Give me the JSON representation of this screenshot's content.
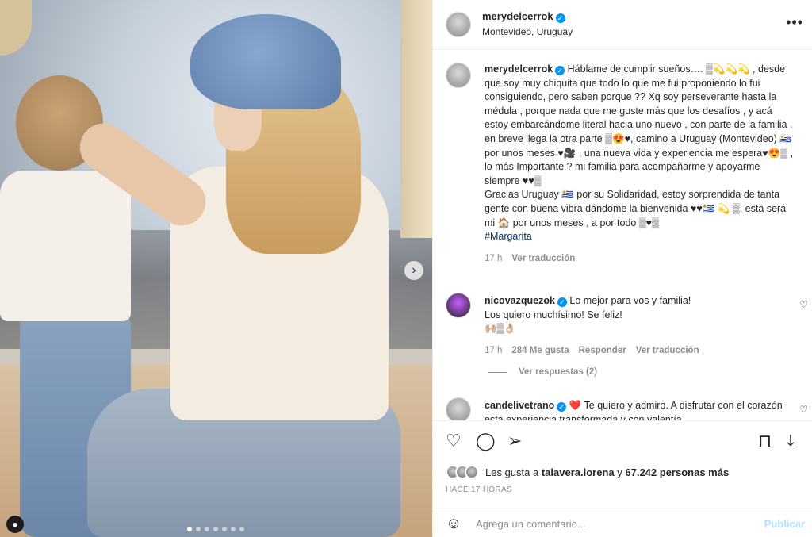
{
  "post": {
    "username": "merydelcerrok",
    "location": "Montevideo, Uruguay",
    "more_icon": "more-horizontal-icon",
    "carousel": {
      "slide_count": 7,
      "active_index": 0
    }
  },
  "caption": {
    "username": "merydelcerrok",
    "text": "Háblame de cumplir sueños…. ▒💫💫💫 , desde que soy muy chiquita que todo lo que me fui proponiendo lo fui consiguiendo, pero saben porque ?? Xq soy perseverante hasta la médula , porque nada que me guste más que los desafíos , y acá estoy embarcándome literal hacia uno nuevo , con parte de la familia , en breve llega la otra parte ▒😍♥, camino a Uruguay (Montevideo) 🇺🇾 por unos meses ♥🎥 , una nueva vida y experiencia me espera♥😍▒ , lo más Importante ? mi familia para acompañarme y apoyarme siempre ♥♥▒",
    "text2": "Gracias Uruguay 🇺🇾 por su Solidaridad, estoy sorprendida de tanta gente con buena vibra dándome la bienvenida ♥♥🇺🇾 💫 ▒, esta será mi 🏠 por unos meses , a por todo ▒♥▒",
    "hashtag": "#Margarita",
    "time": "17 h",
    "translate": "Ver traducción"
  },
  "comments": [
    {
      "username": "nicovazquezok",
      "text": "Lo mejor para vos y familia!",
      "text2": "Los quiero muchísimo! Se feliz!",
      "text3": "🙌🏼▒👌🏼",
      "time": "17 h",
      "likes": "284 Me gusta",
      "reply": "Responder",
      "translate": "Ver traducción",
      "view_replies": "Ver respuestas (2)"
    },
    {
      "username": "candelivetrano",
      "text": "❤️ Te quiero y admiro. A disfrutar con el corazón esta experiencia transformada y con valentía"
    }
  ],
  "actions": {
    "like_icon": "heart-icon",
    "comment_icon": "comment-icon",
    "share_icon": "share-icon",
    "save_icon": "bookmark-icon",
    "download_icon": "download-icon"
  },
  "likes": {
    "prefix": "Les gusta a",
    "user": "talavera.lorena",
    "connector": "y",
    "others": "67.242 personas más"
  },
  "ago": "HACE 17 HORAS",
  "add_comment": {
    "placeholder": "Agrega un comentario...",
    "publish": "Publicar",
    "emoji_icon": "smiley-icon"
  }
}
